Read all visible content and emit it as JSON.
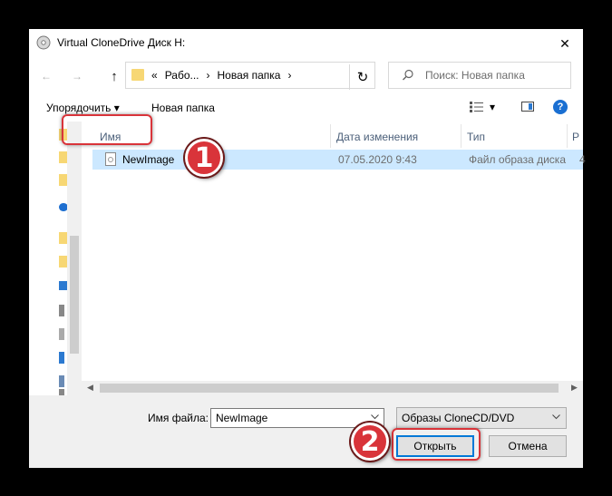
{
  "window": {
    "title": "Virtual CloneDrive Диск H:",
    "close_symbol": "✕"
  },
  "nav": {
    "back_symbol": "←",
    "forward_symbol": "→",
    "up_symbol": "↑",
    "breadcrumb": [
      "«",
      "Рабо...",
      "›",
      "Новая папка",
      "›"
    ],
    "refresh_symbol": "↻",
    "search_placeholder": "Поиск: Новая папка"
  },
  "toolbar": {
    "organize_label": "Упорядочить ▾",
    "new_folder_label": "Новая папка",
    "view_symbol": "▾",
    "help_symbol": "?"
  },
  "columns": {
    "name": "Имя",
    "date": "Дата изменения",
    "type": "Тип",
    "size": "Р"
  },
  "files": [
    {
      "name": "NewImage",
      "date": "07.05.2020 9:43",
      "type": "Файл образа диска",
      "size": "4"
    }
  ],
  "footer": {
    "filename_label": "Имя файла:",
    "filename_value": "NewImage",
    "filter_value": "Образы CloneCD/DVD",
    "open_label": "Открыть",
    "cancel_label": "Отмена"
  },
  "markers": {
    "step1": "1",
    "step2": "2"
  },
  "colors": {
    "accent": "#0078d7",
    "selection": "#cce8ff",
    "marker": "#d9343a"
  }
}
